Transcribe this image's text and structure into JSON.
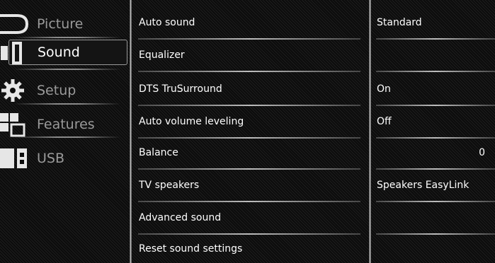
{
  "menu": {
    "items": [
      {
        "label": "Picture",
        "icon": "picture-icon"
      },
      {
        "label": "Sound",
        "icon": "speaker-icon",
        "selected": true
      },
      {
        "label": "Setup",
        "icon": "gear-icon"
      },
      {
        "label": "Features",
        "icon": "features-icon"
      },
      {
        "label": "USB",
        "icon": "usb-icon"
      }
    ]
  },
  "options": [
    {
      "label": "Auto sound",
      "value": "Standard"
    },
    {
      "label": "Equalizer",
      "value": ""
    },
    {
      "label": "DTS TruSurround",
      "value": "On"
    },
    {
      "label": "Auto volume leveling",
      "value": "Off"
    },
    {
      "label": "Balance",
      "value": "0"
    },
    {
      "label": "TV speakers",
      "value": "Speakers EasyLink"
    },
    {
      "label": "Advanced sound",
      "value": ""
    },
    {
      "label": "Reset sound settings",
      "value": ""
    }
  ],
  "colors": {
    "background": "#0c0c0c",
    "text": "#ffffff",
    "dim_text": "#9a9a9a"
  }
}
